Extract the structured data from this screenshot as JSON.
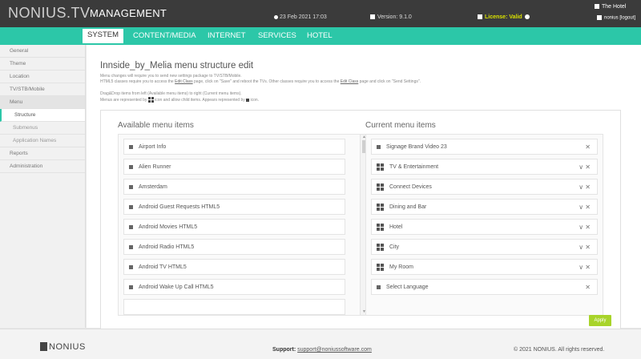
{
  "topbar": {
    "brand": "NONIUS.TV",
    "section": "MANAGEMENT",
    "datetime": "23 Feb 2021 17:03",
    "version": "Version: 9.1.0",
    "license": "License: Valid",
    "hotel": "The Hotel",
    "user": "nonius [logout]"
  },
  "tabs": [
    "SYSTEM",
    "CONTENT/MEDIA",
    "INTERNET",
    "SERVICES",
    "HOTEL"
  ],
  "sidebar": {
    "items": [
      "General",
      "Theme",
      "Location",
      "TV/STB/Mobile",
      "Menu",
      "Structure",
      "Submenus",
      "Application Names",
      "Reports",
      "Administration"
    ]
  },
  "main": {
    "title": "Innside_by_Melia menu structure edit",
    "note1": "Menu changes will require you to send new settings package to TV/STB/Mobile.",
    "note2_a": "HTML5 classes require you to access the ",
    "note2_link1": "Edit Class",
    "note2_b": " page, click on \"Save\" and reboot the TVs. Other classes require you to access the ",
    "note2_link2": "Edit Class",
    "note2_c": " page and click on \"Send Settings\".",
    "note3": "Drag&Drop items from left (Available menu items) to right (Current menu items).",
    "note4_a": "Menus are represented by",
    "note4_b": "icon and allow child items. Appears represented by",
    "note4_c": "icon.",
    "available_title": "Available menu items",
    "current_title": "Current menu items",
    "available_items": [
      "Airport Info",
      "Alien Runner",
      "Amsterdam",
      "Android Guest Requests HTML5",
      "Android Movies HTML5",
      "Android Radio HTML5",
      "Android TV HTML5",
      "Android Wake Up Call HTML5"
    ],
    "current_items": [
      {
        "label": "Signage Brand Video 23",
        "kind": "item",
        "actions": "✕"
      },
      {
        "label": "TV & Entertainment",
        "kind": "menu",
        "actions": "∨ ✕"
      },
      {
        "label": "Connect Devices",
        "kind": "menu",
        "actions": "∨ ✕"
      },
      {
        "label": "Dining and Bar",
        "kind": "menu",
        "actions": "∨ ✕"
      },
      {
        "label": "Hotel",
        "kind": "menu",
        "actions": "∨ ✕"
      },
      {
        "label": "City",
        "kind": "menu",
        "actions": "∨ ✕"
      },
      {
        "label": "My Room",
        "kind": "menu",
        "actions": "∨ ✕"
      },
      {
        "label": "Select Language",
        "kind": "item",
        "actions": "✕"
      }
    ],
    "apply_label": "Apply"
  },
  "footer": {
    "logo": "NONIUS",
    "support_label": "Support:",
    "support_email": "support@noniussoftware.com",
    "copyright": "© 2021 NONIUS. All rights reserved."
  },
  "colors": {
    "accent": "#2cc7a8",
    "topbar": "#3b3b3b",
    "apply": "#a8d42a",
    "license": "#d8e000"
  }
}
